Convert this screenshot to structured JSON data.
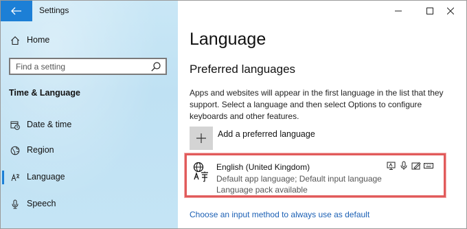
{
  "window": {
    "app_title": "Settings",
    "controls": [
      "minimize",
      "maximize",
      "close"
    ]
  },
  "sidebar": {
    "home_label": "Home",
    "search": {
      "placeholder": "Find a setting",
      "value": ""
    },
    "section_heading": "Time & Language",
    "items": [
      {
        "label": "Date & time",
        "icon": "calendar-clock-icon",
        "selected": false
      },
      {
        "label": "Region",
        "icon": "globe-region-icon",
        "selected": false
      },
      {
        "label": "Language",
        "icon": "language-icon",
        "selected": true
      },
      {
        "label": "Speech",
        "icon": "microphone-icon",
        "selected": false
      }
    ]
  },
  "main": {
    "page_title": "Language",
    "section_title": "Preferred languages",
    "description": "Apps and websites will appear in the first language in the list that they support. Select a language and then select Options to configure keyboards and other features.",
    "add_language_label": "Add a preferred language",
    "language_item": {
      "name": "English (United Kingdom)",
      "detail_line1": "Default app language; Default input language",
      "detail_line2": "Language pack available",
      "feature_icons": [
        "display-language-icon",
        "speech-icon",
        "handwriting-icon",
        "keyboard-icon"
      ]
    },
    "input_method_link": "Choose an input method to always use as default"
  },
  "colors": {
    "accent": "#1c7fd6",
    "highlight_border": "#e15b5b",
    "sidebar_bg": "#c4e4f5",
    "link": "#1a5fb4"
  }
}
